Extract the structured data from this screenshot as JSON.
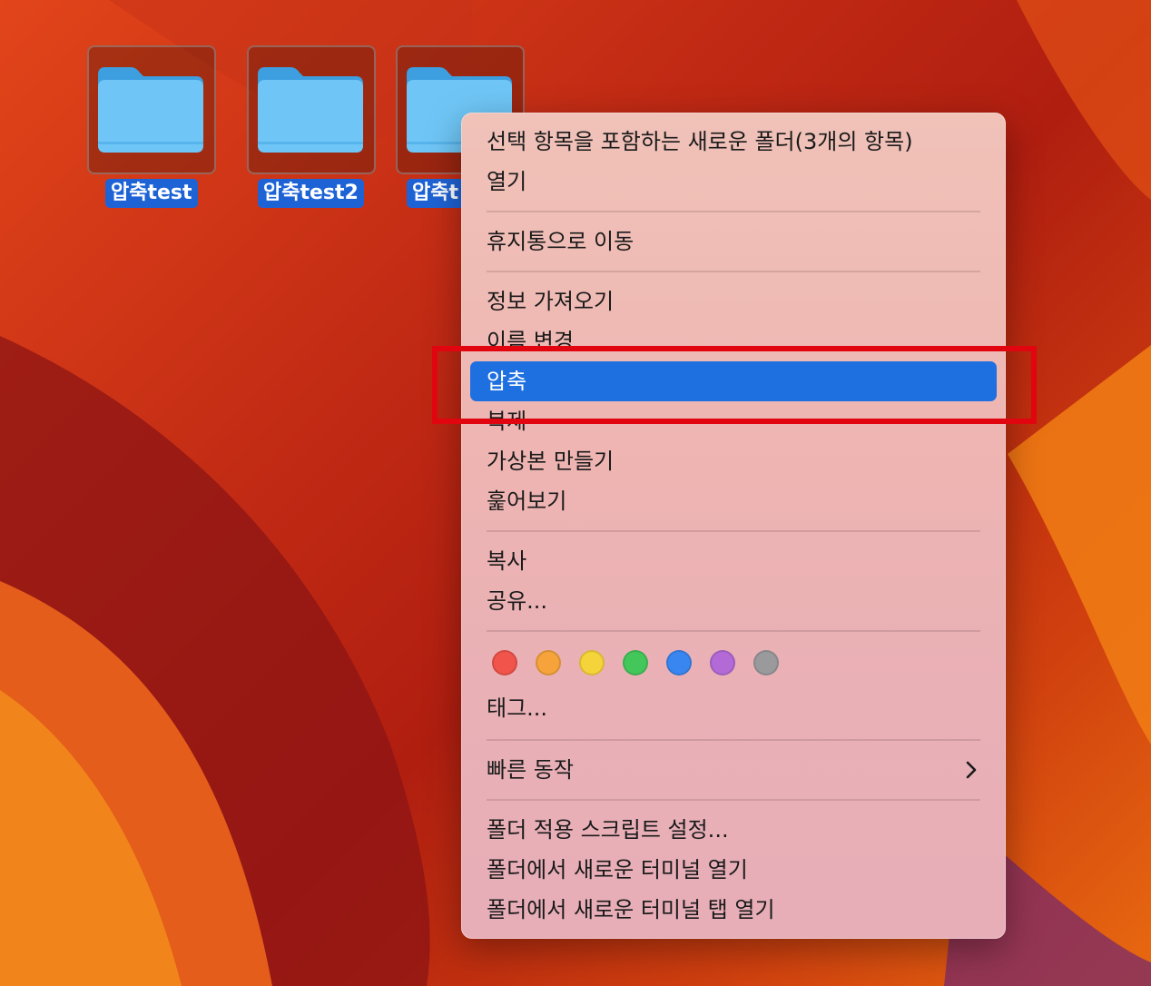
{
  "desktop": {
    "folders": [
      {
        "name": "압축test"
      },
      {
        "name": "압축test2"
      },
      {
        "name": "압축t"
      }
    ]
  },
  "context_menu": {
    "items": [
      {
        "label": "선택 항목을 포함하는 새로운 폴더(3개의 항목)"
      },
      {
        "label": "열기"
      },
      {
        "label": "휴지통으로 이동"
      },
      {
        "label": "정보 가져오기"
      },
      {
        "label": "이름 변경"
      },
      {
        "label": "압축",
        "highlighted": true
      },
      {
        "label": "복제"
      },
      {
        "label": "가상본 만들기"
      },
      {
        "label": "훑어보기"
      },
      {
        "label": "복사"
      },
      {
        "label": "공유..."
      },
      {
        "label": "태그..."
      },
      {
        "label": "빠른 동작",
        "submenu": true
      },
      {
        "label": "폴더 적용 스크립트 설정..."
      },
      {
        "label": "폴더에서 새로운 터미널 열기"
      },
      {
        "label": "폴더에서 새로운 터미널 탭 열기"
      }
    ],
    "tag_colors": [
      {
        "name": "red",
        "color": "#f0544a"
      },
      {
        "name": "orange",
        "color": "#f5a33a"
      },
      {
        "name": "yellow",
        "color": "#f5d33a"
      },
      {
        "name": "green",
        "color": "#44c75a"
      },
      {
        "name": "blue",
        "color": "#3a86f0"
      },
      {
        "name": "purple",
        "color": "#b36ad6"
      },
      {
        "name": "gray",
        "color": "#9a9a9c"
      }
    ],
    "highlight_color": "#1e6fe0"
  },
  "annotation": {
    "box_color": "#e0050f"
  }
}
